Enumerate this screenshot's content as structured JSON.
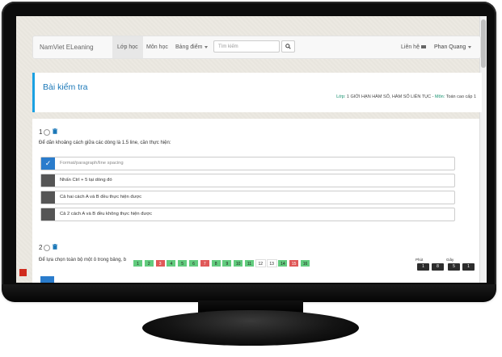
{
  "navbar": {
    "brand": "NamViet ELeaning",
    "items": [
      {
        "label": "Lớp học",
        "active": true
      },
      {
        "label": "Môn học",
        "active": false
      },
      {
        "label": "Bảng điểm",
        "dropdown": true
      }
    ],
    "search_placeholder": "Tìm kiếm",
    "contact": "Liên hệ",
    "user": "Phan Quang"
  },
  "header": {
    "title": "Bài kiểm tra",
    "class_label": "Lớp:",
    "class_value": " 1 GIỚI HẠN HÀM SỐ, HÀM SỐ LIÊN TỤC - ",
    "subject_label": "Môn:",
    "subject_value": " Toán cao cấp 1"
  },
  "question1": {
    "number": "1",
    "text": "Để dãn khoảng cách giữa các dòng là 1.5 line, cần thực hiện:",
    "options": [
      {
        "label": "Format/paragraph/line spacing",
        "checked": true
      },
      {
        "label": "Nhấn Ctrl + 5 tại dòng đó",
        "checked": false
      },
      {
        "label": "Cả hai cách A và B đều thực hiện được",
        "checked": false
      },
      {
        "label": "Cả 2 cách A và B đều không thực hiện được",
        "checked": false
      }
    ]
  },
  "question2": {
    "number": "2",
    "text": "Để lựa chọn toàn bộ một ô trong bảng, b"
  },
  "pager": [
    {
      "n": "1",
      "s": "g"
    },
    {
      "n": "2",
      "s": "g"
    },
    {
      "n": "3",
      "s": "r"
    },
    {
      "n": "4",
      "s": "g"
    },
    {
      "n": "5",
      "s": "g"
    },
    {
      "n": "6",
      "s": "g"
    },
    {
      "n": "7",
      "s": "r"
    },
    {
      "n": "8",
      "s": "g"
    },
    {
      "n": "9",
      "s": "g"
    },
    {
      "n": "10",
      "s": "g"
    },
    {
      "n": "11",
      "s": "g"
    },
    {
      "n": "12",
      "s": "w"
    },
    {
      "n": "13",
      "s": "w"
    },
    {
      "n": "14",
      "s": "g"
    },
    {
      "n": "15",
      "s": "r"
    },
    {
      "n": "16",
      "s": "g"
    }
  ],
  "timer": {
    "minute_label": "Phút",
    "second_label": "Giây",
    "digits": [
      "1",
      "8",
      "5",
      "1"
    ]
  },
  "colors": {
    "accent": "#1ba1e2",
    "answered": "#62cc7e",
    "flagged": "#e05858",
    "selected": "#2a7ccc"
  }
}
